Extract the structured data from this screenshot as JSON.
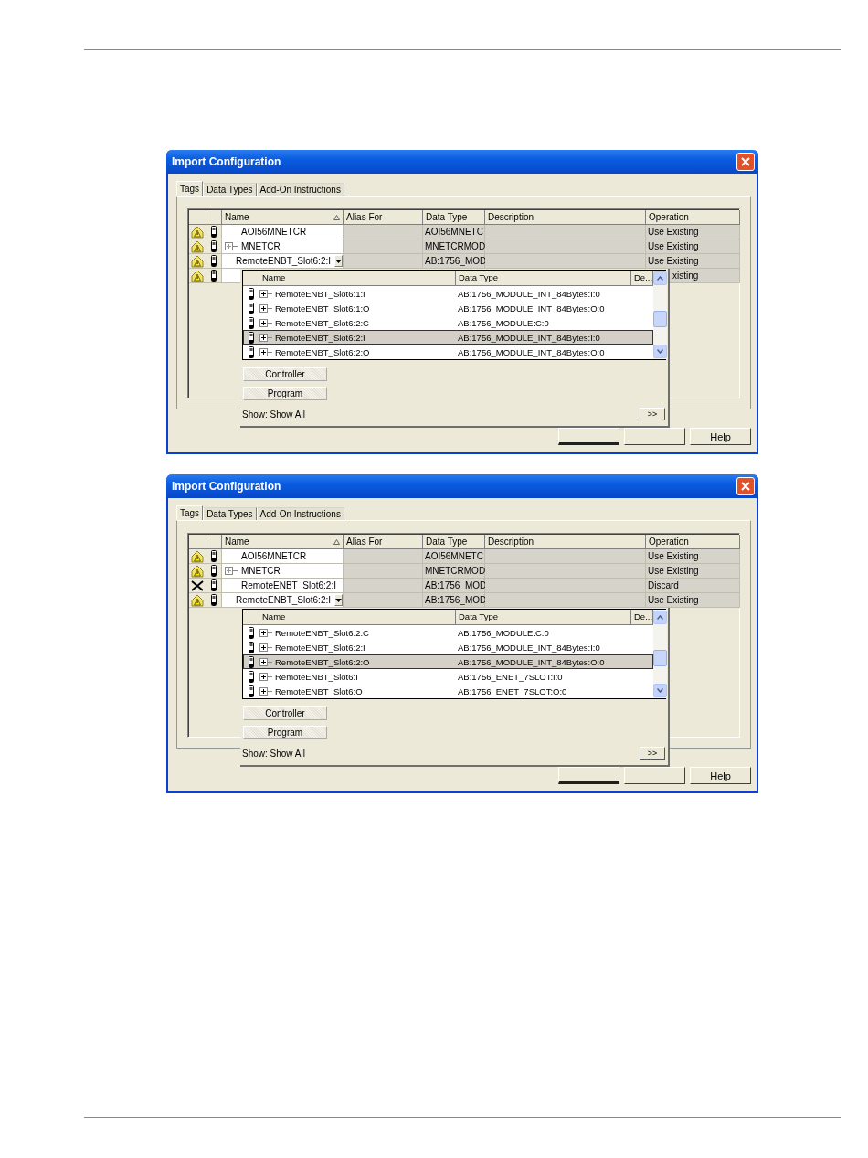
{
  "dialogs": [
    {
      "title": "Import Configuration",
      "tabs": [
        {
          "label": "Tags",
          "selected": true
        },
        {
          "label": "Data Types",
          "selected": false
        },
        {
          "label": "Add-On Instructions",
          "selected": false
        }
      ],
      "columns": [
        "Name",
        "Alias For",
        "Data Type",
        "Description",
        "Operation"
      ],
      "rows": [
        {
          "kind": "warning",
          "expandable": false,
          "dropdown": false,
          "name": "AOI56MNETCR",
          "data_type": "AOI56MNETC",
          "operation": "Use Existing"
        },
        {
          "kind": "warning",
          "expandable": true,
          "dropdown": false,
          "name": "MNETCR",
          "data_type": "MNETCRMOD",
          "operation": "Use Existing"
        },
        {
          "kind": "warning",
          "expandable": false,
          "dropdown": true,
          "name": "RemoteENBT_Slot6:2:I",
          "data_type": "AB:1756_MOD",
          "operation": "Use Existing"
        },
        {
          "kind": "warning",
          "expandable": false,
          "dropdown": false,
          "operation": "xisting"
        }
      ],
      "picker": {
        "columns": [
          "Name",
          "Data Type",
          "De..."
        ],
        "rows": [
          {
            "name": "RemoteENBT_Slot6:1:I",
            "data_type": "AB:1756_MODULE_INT_84Bytes:I:0",
            "selected": false
          },
          {
            "name": "RemoteENBT_Slot6:1:O",
            "data_type": "AB:1756_MODULE_INT_84Bytes:O:0",
            "selected": false
          },
          {
            "name": "RemoteENBT_Slot6:2:C",
            "data_type": "AB:1756_MODULE:C:0",
            "selected": false
          },
          {
            "name": "RemoteENBT_Slot6:2:I",
            "data_type": "AB:1756_MODULE_INT_84Bytes:I:0",
            "selected": true
          },
          {
            "name": "RemoteENBT_Slot6:2:O",
            "data_type": "AB:1756_MODULE_INT_84Bytes:O:0",
            "selected": false
          }
        ],
        "scope_buttons": [
          "Controller",
          "Program"
        ],
        "show": "Show: Show All",
        "more": ">>"
      },
      "help": "Help"
    },
    {
      "title": "Import Configuration",
      "tabs": [
        {
          "label": "Tags",
          "selected": true
        },
        {
          "label": "Data Types",
          "selected": false
        },
        {
          "label": "Add-On Instructions",
          "selected": false
        }
      ],
      "columns": [
        "Name",
        "Alias For",
        "Data Type",
        "Description",
        "Operation"
      ],
      "rows": [
        {
          "kind": "warning",
          "expandable": false,
          "dropdown": false,
          "name": "AOI56MNETCR",
          "data_type": "AOI56MNETC",
          "operation": "Use Existing"
        },
        {
          "kind": "warning",
          "expandable": true,
          "dropdown": false,
          "name": "MNETCR",
          "data_type": "MNETCRMOD",
          "operation": "Use Existing"
        },
        {
          "kind": "discard",
          "expandable": false,
          "dropdown": false,
          "name": "RemoteENBT_Slot6:2:I",
          "data_type": "AB:1756_MOD",
          "operation": "Discard"
        },
        {
          "kind": "warning",
          "expandable": false,
          "dropdown": true,
          "name": "RemoteENBT_Slot6:2:I",
          "data_type": "AB:1756_MOD",
          "operation": "Use Existing"
        }
      ],
      "picker": {
        "columns": [
          "Name",
          "Data Type",
          "De..."
        ],
        "rows": [
          {
            "name": "RemoteENBT_Slot6:2:C",
            "data_type": "AB:1756_MODULE:C:0",
            "selected": false
          },
          {
            "name": "RemoteENBT_Slot6:2:I",
            "data_type": "AB:1756_MODULE_INT_84Bytes:I:0",
            "selected": false
          },
          {
            "name": "RemoteENBT_Slot6:2:O",
            "data_type": "AB:1756_MODULE_INT_84Bytes:O:0",
            "selected": true
          },
          {
            "name": "RemoteENBT_Slot6:I",
            "data_type": "AB:1756_ENET_7SLOT:I:0",
            "selected": false
          },
          {
            "name": "RemoteENBT_Slot6:O",
            "data_type": "AB:1756_ENET_7SLOT:O:0",
            "selected": false
          }
        ],
        "scope_buttons": [
          "Controller",
          "Program"
        ],
        "show": "Show: Show All",
        "more": ">>"
      },
      "help": "Help"
    }
  ]
}
